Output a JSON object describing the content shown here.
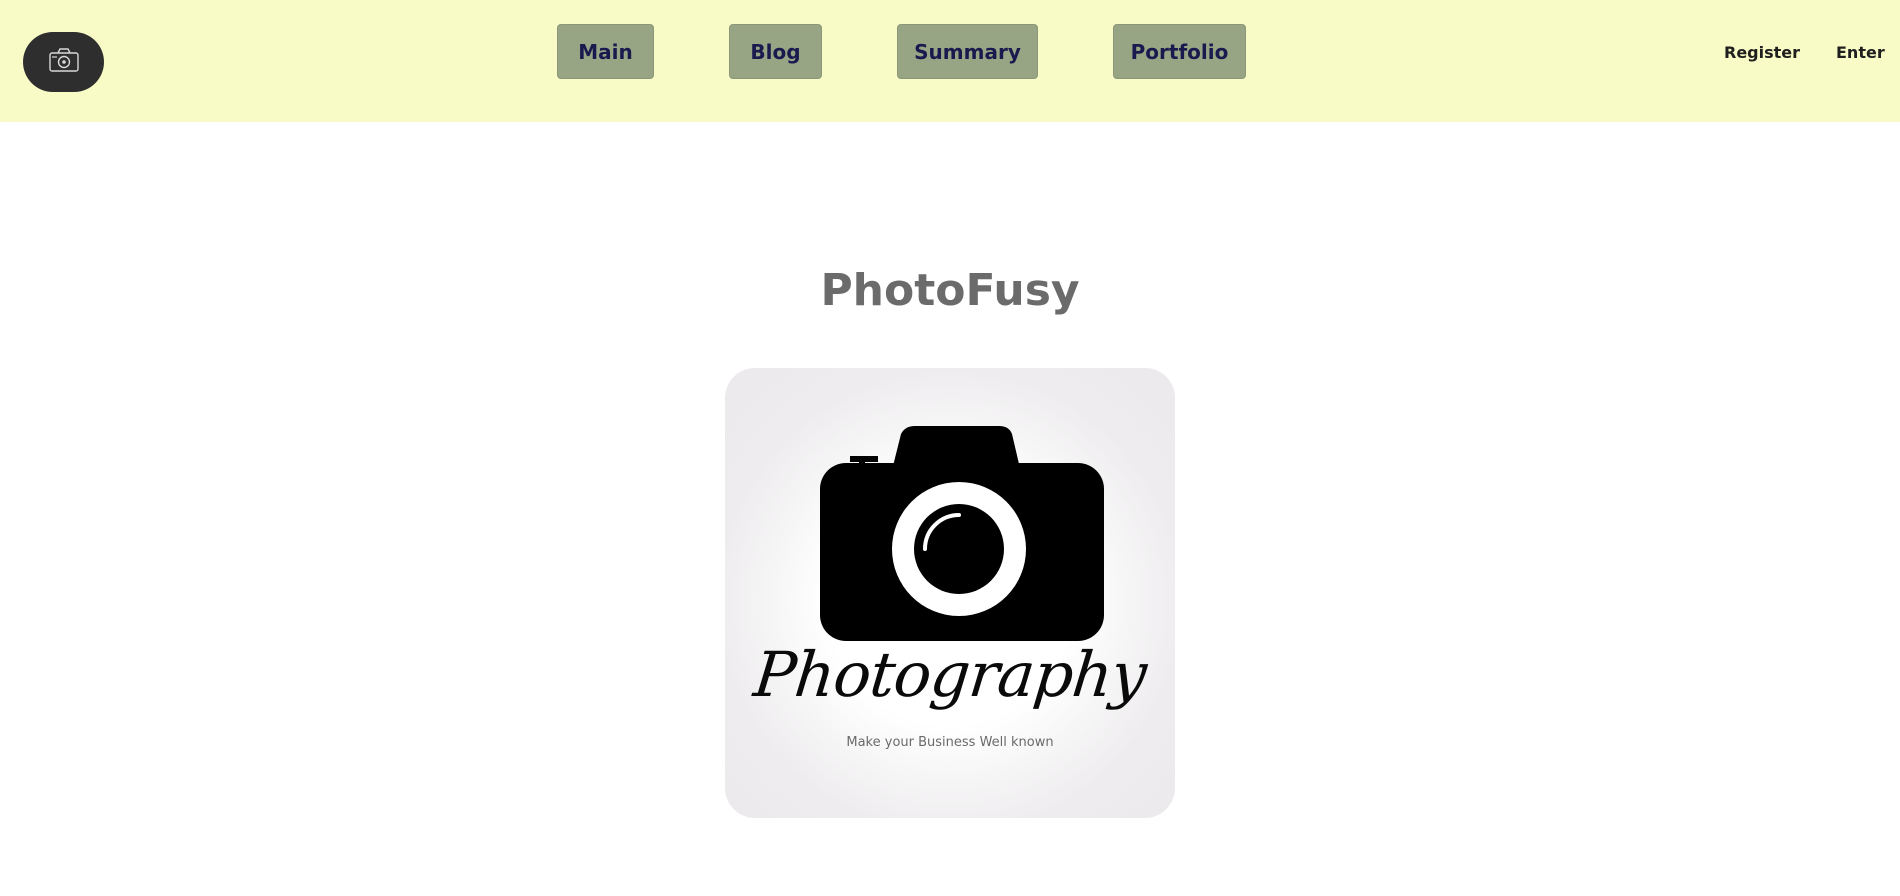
{
  "header": {
    "background": "#f8fbc5",
    "logo_icon": "camera-icon",
    "nav": [
      {
        "label": "Main"
      },
      {
        "label": "Blog"
      },
      {
        "label": "Summary"
      },
      {
        "label": "Portfolio"
      }
    ],
    "register_label": "Register",
    "enter_label": "Enter"
  },
  "main": {
    "title": "PhotoFusy",
    "hero": {
      "script_text": "Photography",
      "tagline": "Make your Business Well known",
      "icon": "camera-icon"
    }
  }
}
